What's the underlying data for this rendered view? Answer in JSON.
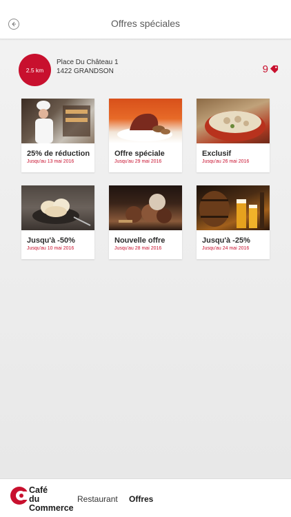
{
  "header": {
    "title": "Offres spéciales",
    "back_icon": "back-arrow-icon"
  },
  "location": {
    "distance": "2.5 km",
    "address_line1": "Place Du Château 1",
    "address_line2": "1422 GRANDSON",
    "offers_count": "9",
    "tag_icon": "tag-icon"
  },
  "offers": [
    {
      "title": "25% de réduction",
      "date": "Jusqu'au 13 mai 2016"
    },
    {
      "title": "Offre spéciale",
      "date": "Jusqu'au 29 mai 2016"
    },
    {
      "title": "Exclusif",
      "date": "Jusqu'au 26 mai 2016"
    },
    {
      "title": "Jusqu'à -50%",
      "date": "Jusqu'au 10 mai 2016"
    },
    {
      "title": "Nouvelle offre",
      "date": "Jusqu'au 28 mai 2016"
    },
    {
      "title": "Jusqu'à -25%",
      "date": "Jusqu'au 24 mai 2016"
    }
  ],
  "bottom_nav": {
    "logo_line1": "Café",
    "logo_line2": "du",
    "logo_line3": "Commerce",
    "restaurant": "Restaurant",
    "offres": "Offres"
  },
  "colors": {
    "accent": "#c8102e"
  }
}
